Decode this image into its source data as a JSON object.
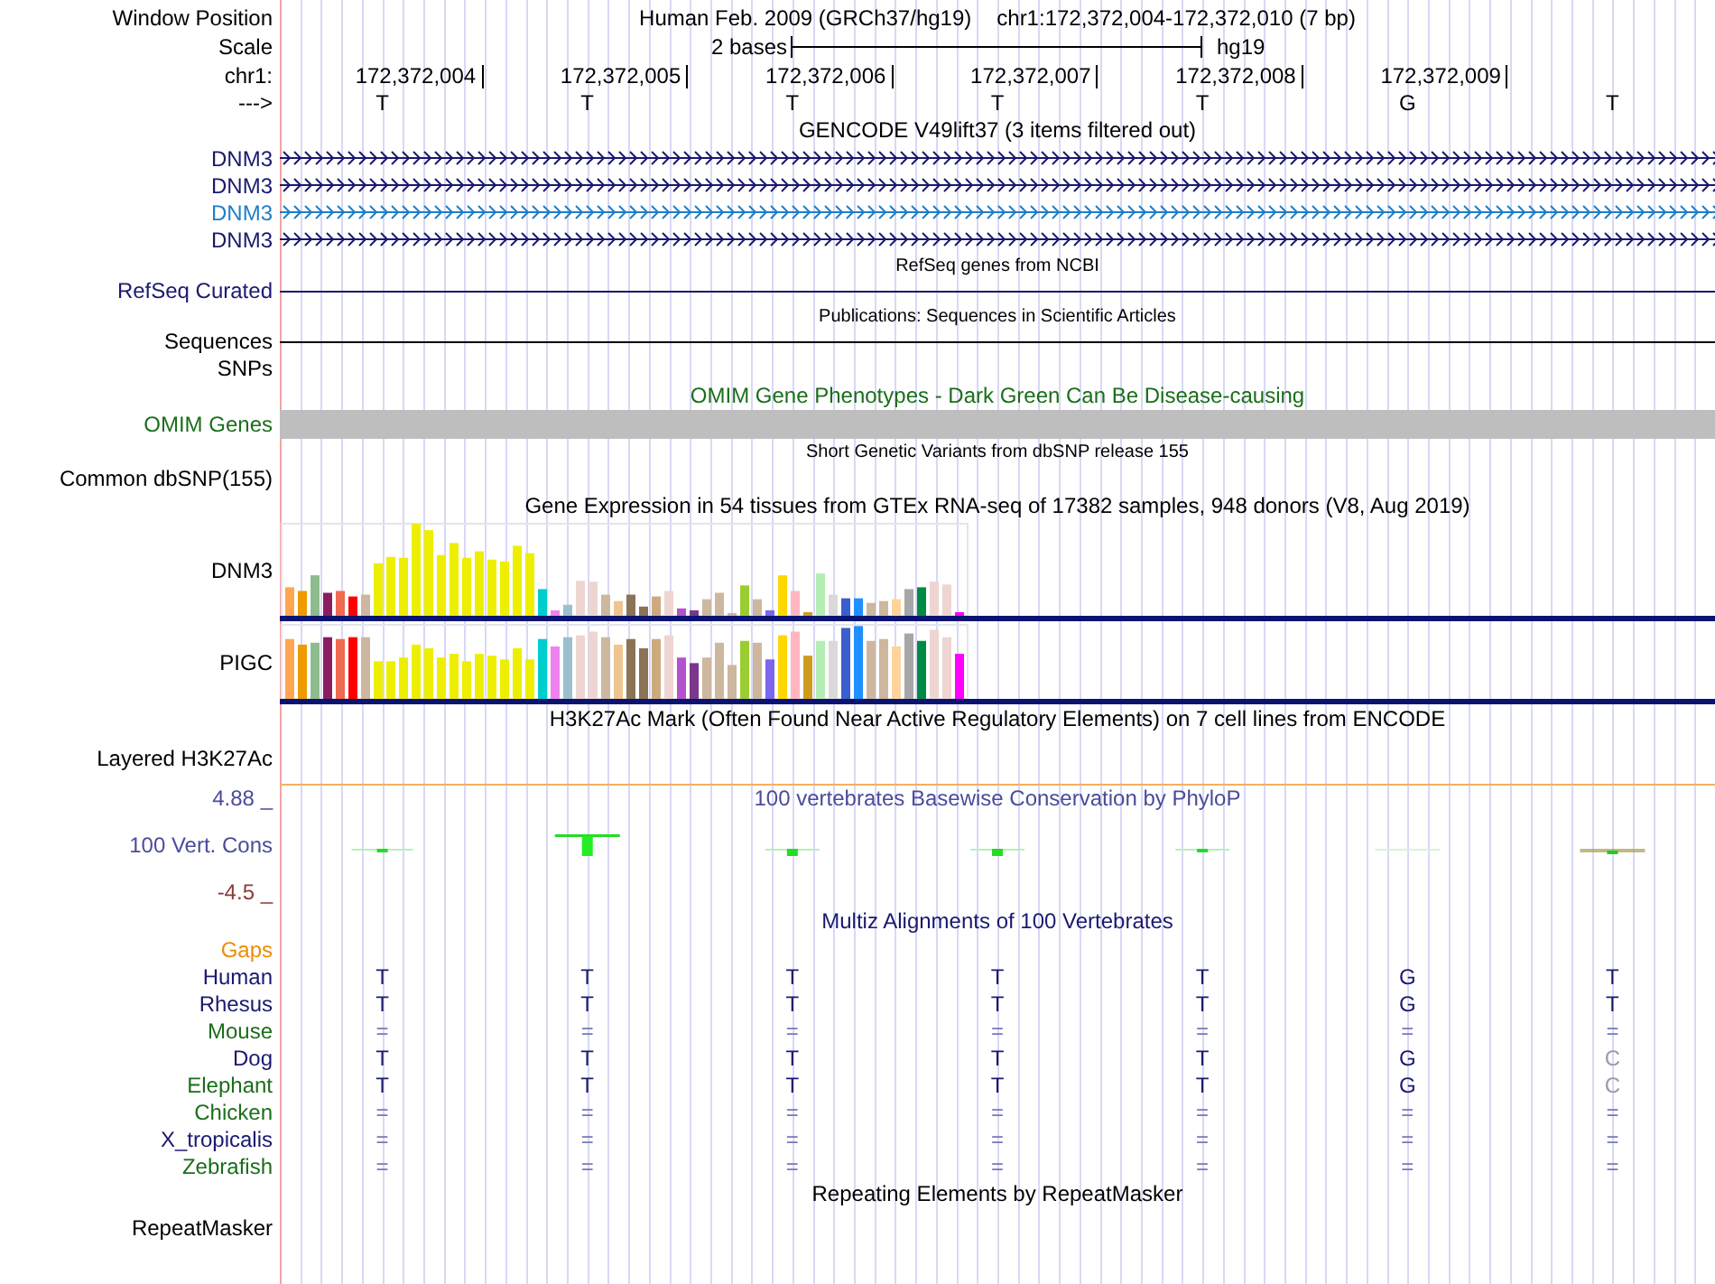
{
  "header": {
    "window_label": "Window Position",
    "assembly": "Human Feb. 2009 (GRCh37/hg19)",
    "position": "chr1:172,372,004-172,372,010 (7 bp)",
    "scale_label": "Scale",
    "scale_text": "2 bases",
    "scale_assembly": "hg19",
    "chrom_label": "chr1:",
    "ticks": [
      "172,372,004",
      "172,372,005",
      "172,372,006",
      "172,372,007",
      "172,372,008",
      "172,372,009"
    ],
    "strand_label": "--->",
    "bases": [
      "T",
      "T",
      "T",
      "T",
      "T",
      "G",
      "T"
    ]
  },
  "tracks": [
    {
      "kind": "feature",
      "title": "GENCODE V49lift37 (3 items filtered out)",
      "color": "#000000",
      "rows": [
        {
          "label": "DNM3",
          "kind": "gene",
          "color": "#191970"
        },
        {
          "label": "DNM3",
          "kind": "gene",
          "color": "#191970"
        },
        {
          "label": "DNM3",
          "kind": "gene",
          "color": "#1e7ec8"
        },
        {
          "label": "DNM3",
          "kind": "gene",
          "color": "#191970"
        }
      ]
    },
    {
      "kind": "annotation",
      "title": "RefSeq genes from NCBI",
      "color": "#000000",
      "rows": [
        {
          "label": "RefSeq Curated",
          "kind": "line",
          "color": "#191970"
        }
      ]
    },
    {
      "kind": "annotation",
      "title": "Publications: Sequences in Scientific Articles",
      "color": "#000000",
      "rows": [
        {
          "label": "Sequences",
          "kind": "line",
          "color": "#000000"
        },
        {
          "label": "SNPs",
          "kind": "empty",
          "color": "#000000"
        }
      ]
    },
    {
      "kind": "feature",
      "title": "OMIM Gene Phenotypes - Dark Green Can Be Disease-causing",
      "color": "#1a6e1a",
      "rows": [
        {
          "label": "OMIM Genes",
          "kind": "bar",
          "color": "#1a6e1a"
        }
      ]
    },
    {
      "kind": "annotation",
      "title": "Short Genetic Variants from dbSNP release 155",
      "color": "#000000",
      "rows": [
        {
          "label": "Common dbSNP(155)",
          "kind": "empty",
          "color": "#000000"
        }
      ]
    },
    {
      "kind": "feature",
      "title": "Gene Expression in 54 tissues from GTEx RNA-seq of 17382 samples, 948 donors (V8, Aug 2019)",
      "color": "#000000",
      "rows": [
        {
          "label": "DNM3",
          "kind": "expression",
          "color": "#000000"
        },
        {
          "label": "PIGC",
          "kind": "expression",
          "color": "#000000"
        }
      ]
    },
    {
      "kind": "feature",
      "title": "H3K27Ac Mark (Often Found Near Active Regulatory Elements) on 7 cell lines from ENCODE",
      "color": "#000000",
      "rows": [
        {
          "label": "Layered H3K27Ac",
          "kind": "layered",
          "color": "#000000"
        }
      ]
    },
    {
      "kind": "wiggle",
      "title": "100 vertebrates Basewise Conservation by PhyloP",
      "color": "#4b4b9b",
      "max": "4.88 _",
      "min": "-4.5 _",
      "rows": [
        {
          "label": "100 Vert. Cons",
          "kind": "wiggle",
          "color": "#4b4b9b"
        }
      ]
    },
    {
      "kind": "feature",
      "title": "Multiz Alignments of 100 Vertebrates",
      "color": "#191970",
      "rows": [
        {
          "label": "Gaps",
          "kind": "empty",
          "color": "#ee8c00"
        },
        {
          "label": "Human",
          "kind": "alignment",
          "color": "#191970",
          "bases": [
            {
              "text": "T",
              "kind": "base"
            },
            {
              "text": "T",
              "kind": "base"
            },
            {
              "text": "T",
              "kind": "base"
            },
            {
              "text": "T",
              "kind": "base"
            },
            {
              "text": "T",
              "kind": "base"
            },
            {
              "text": "G",
              "kind": "base"
            },
            {
              "text": "T",
              "kind": "base"
            }
          ]
        },
        {
          "label": "Rhesus",
          "kind": "alignment",
          "color": "#191970",
          "bases": [
            {
              "text": "T",
              "kind": "base"
            },
            {
              "text": "T",
              "kind": "base"
            },
            {
              "text": "T",
              "kind": "base"
            },
            {
              "text": "T",
              "kind": "base"
            },
            {
              "text": "T",
              "kind": "base"
            },
            {
              "text": "G",
              "kind": "base"
            },
            {
              "text": "T",
              "kind": "base"
            }
          ]
        },
        {
          "label": "Mouse",
          "kind": "alignment",
          "color": "#1a6e1a",
          "bases": [
            {
              "text": "=",
              "kind": "gap"
            },
            {
              "text": "=",
              "kind": "gap"
            },
            {
              "text": "=",
              "kind": "gap"
            },
            {
              "text": "=",
              "kind": "gap"
            },
            {
              "text": "=",
              "kind": "gap"
            },
            {
              "text": "=",
              "kind": "gap"
            },
            {
              "text": "=",
              "kind": "gap"
            }
          ]
        },
        {
          "label": "Dog",
          "kind": "alignment",
          "color": "#191970",
          "bases": [
            {
              "text": "T",
              "kind": "base"
            },
            {
              "text": "T",
              "kind": "base"
            },
            {
              "text": "T",
              "kind": "base"
            },
            {
              "text": "T",
              "kind": "base"
            },
            {
              "text": "T",
              "kind": "base"
            },
            {
              "text": "G",
              "kind": "base"
            },
            {
              "text": "C",
              "kind": "mismatch"
            }
          ]
        },
        {
          "label": "Elephant",
          "kind": "alignment",
          "color": "#1a6e1a",
          "bases": [
            {
              "text": "T",
              "kind": "base"
            },
            {
              "text": "T",
              "kind": "base"
            },
            {
              "text": "T",
              "kind": "base"
            },
            {
              "text": "T",
              "kind": "base"
            },
            {
              "text": "T",
              "kind": "base"
            },
            {
              "text": "G",
              "kind": "base"
            },
            {
              "text": "C",
              "kind": "mismatch"
            }
          ]
        },
        {
          "label": "Chicken",
          "kind": "alignment",
          "color": "#1a6e1a",
          "bases": [
            {
              "text": "=",
              "kind": "gap"
            },
            {
              "text": "=",
              "kind": "gap"
            },
            {
              "text": "=",
              "kind": "gap"
            },
            {
              "text": "=",
              "kind": "gap"
            },
            {
              "text": "=",
              "kind": "gap"
            },
            {
              "text": "=",
              "kind": "gap"
            },
            {
              "text": "=",
              "kind": "gap"
            }
          ]
        },
        {
          "label": "X_tropicalis",
          "kind": "alignment",
          "color": "#191970",
          "bases": [
            {
              "text": "=",
              "kind": "gap"
            },
            {
              "text": "=",
              "kind": "gap"
            },
            {
              "text": "=",
              "kind": "gap"
            },
            {
              "text": "=",
              "kind": "gap"
            },
            {
              "text": "=",
              "kind": "gap"
            },
            {
              "text": "=",
              "kind": "gap"
            },
            {
              "text": "=",
              "kind": "gap"
            }
          ]
        },
        {
          "label": "Zebrafish",
          "kind": "alignment",
          "color": "#1a6e1a",
          "bases": [
            {
              "text": "=",
              "kind": "gap"
            },
            {
              "text": "=",
              "kind": "gap"
            },
            {
              "text": "=",
              "kind": "gap"
            },
            {
              "text": "=",
              "kind": "gap"
            },
            {
              "text": "=",
              "kind": "gap"
            },
            {
              "text": "=",
              "kind": "gap"
            },
            {
              "text": "=",
              "kind": "gap"
            }
          ]
        }
      ]
    },
    {
      "kind": "feature",
      "title": "Repeating Elements by RepeatMasker",
      "color": "#000000",
      "rows": [
        {
          "label": "RepeatMasker",
          "kind": "repeat",
          "color": "#000000"
        }
      ]
    }
  ]
}
